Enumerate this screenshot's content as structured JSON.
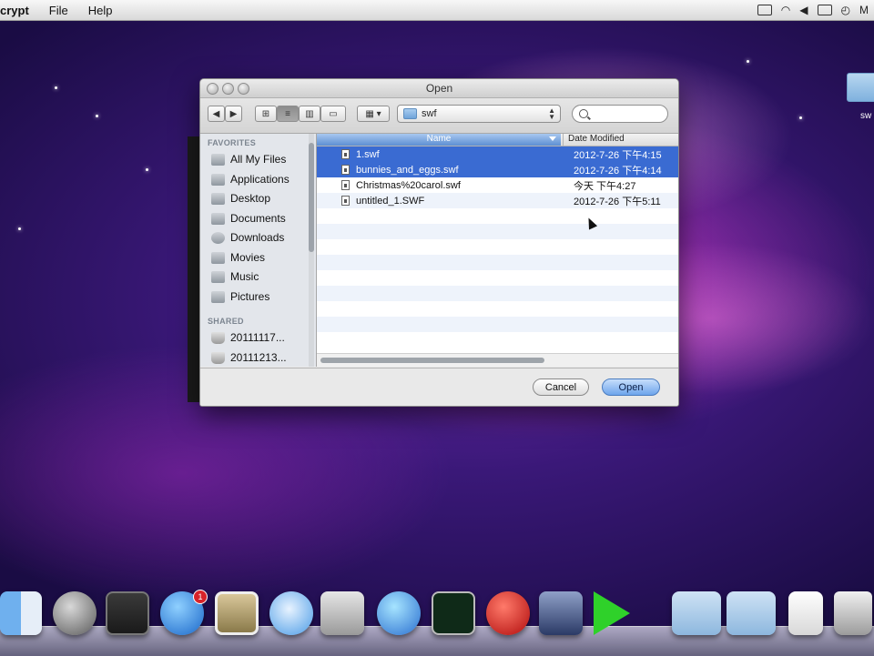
{
  "menubar": {
    "app_name": "crypt",
    "items": [
      "File",
      "Help"
    ],
    "right_text": "M"
  },
  "desktop": {
    "folder_label": "sw"
  },
  "dialog": {
    "title": "Open",
    "toolbar": {
      "path": "swf",
      "search_placeholder": ""
    },
    "sidebar": {
      "favorites_header": "FAVORITES",
      "favorites": [
        "All My Files",
        "Applications",
        "Desktop",
        "Documents",
        "Downloads",
        "Movies",
        "Music",
        "Pictures"
      ],
      "shared_header": "SHARED",
      "shared": [
        "20111117...",
        "20111213..."
      ]
    },
    "columns": {
      "name": "Name",
      "date": "Date Modified"
    },
    "files": [
      {
        "name": "1.swf",
        "date": "2012-7-26 下午4:15",
        "selected": true
      },
      {
        "name": "bunnies_and_eggs.swf",
        "date": "2012-7-26 下午4:14",
        "selected": true
      },
      {
        "name": "Christmas%20carol.swf",
        "date": "今天 下午4:27",
        "selected": false
      },
      {
        "name": "untitled_1.SWF",
        "date": "2012-7-26 下午5:11",
        "selected": false
      }
    ],
    "buttons": {
      "cancel": "Cancel",
      "open": "Open"
    }
  },
  "dock": {
    "appstore_badge": "1",
    "icons": [
      "finder-icon",
      "launchpad-icon",
      "dashboard-icon",
      "app-store-icon",
      "preview-icon",
      "safari-icon",
      "facetime-icon",
      "itunes-icon",
      "activity-monitor-icon",
      "flash-icon",
      "photo-booth-icon",
      "play-icon",
      "applications-folder-icon",
      "documents-folder-icon",
      "file-icon",
      "trash-icon"
    ]
  },
  "colors": {
    "selection": "#3a6bd2",
    "accent_button": "#6ea5ec",
    "wallpaper_base": "#3a1878"
  }
}
